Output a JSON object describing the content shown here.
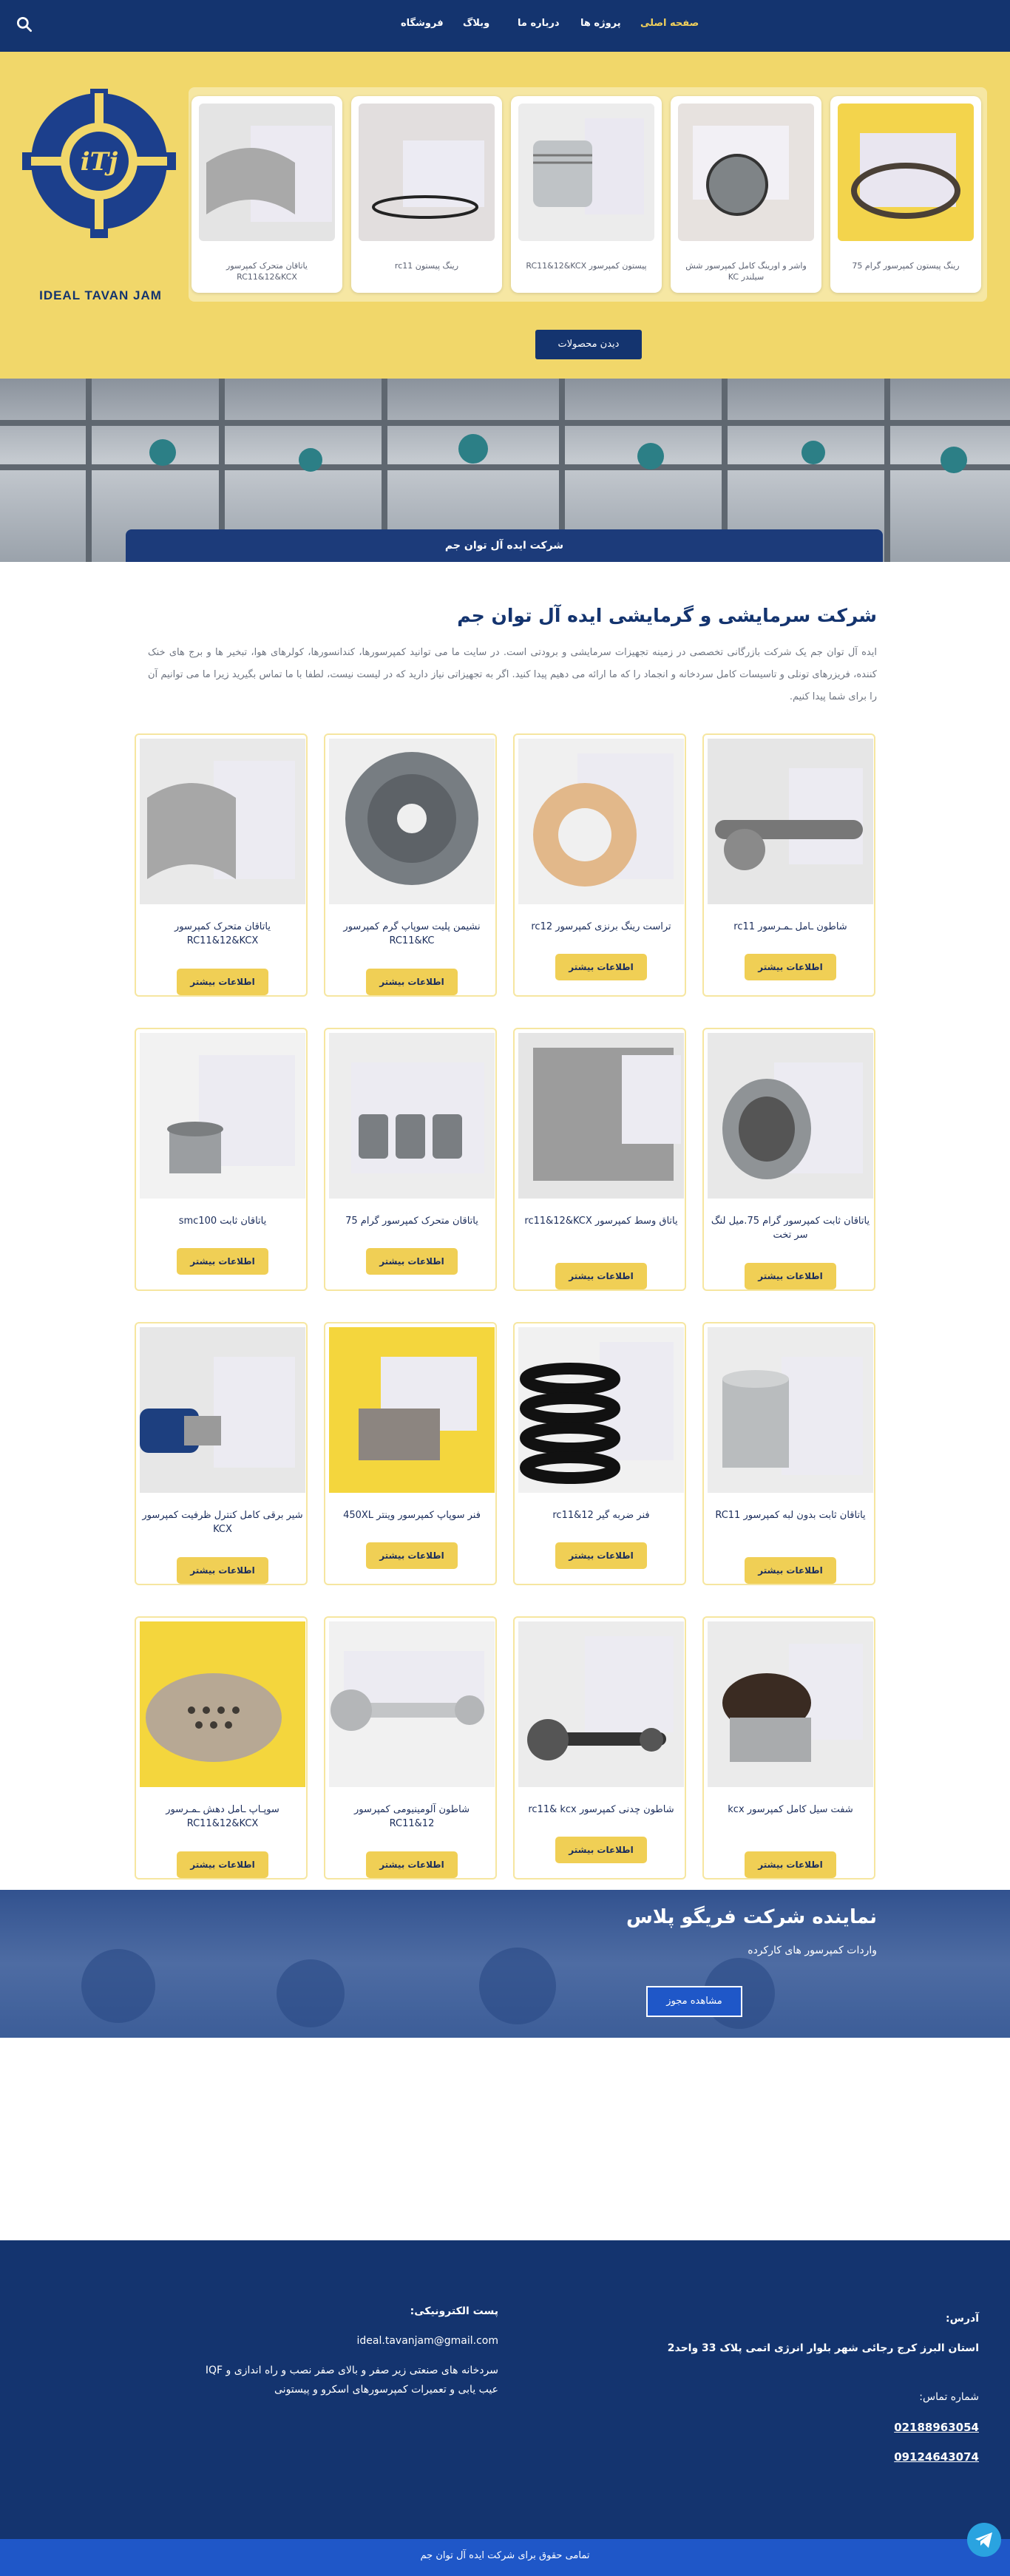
{
  "nav": {
    "items": [
      "صفحه اصلی",
      "پروژه ها",
      "درباره ما",
      "وبلاگ",
      "فروشگاه"
    ]
  },
  "logo": {
    "text": "IDEAL TAVAN JAM",
    "initials": "iTj"
  },
  "carousel": {
    "items": [
      "رینگ پیستون کمپرسور گرام 75",
      "واشر و اورینگ کامل کمپرسور شش سیلندر KC",
      "پیستون کمپرسور RC11&12&KCX",
      "رینگ پیستون rc11",
      "یاتاقان متحرک کمپرسور RC11&12&KCX"
    ],
    "button": "دیدن محصولات"
  },
  "banner": {
    "caption": "شرکت ایده آل توان جم"
  },
  "about": {
    "title": "شرکت سرمایشی و گرمایشی ایده آل توان جم",
    "text": "ایده آل توان جم یک شرکت بازرگانی تخصصی در زمینه تجهیزات سرمایشی و برودتی است. در سایت ما می توانید کمپرسورها، کندانسورها، کولرهای هوا، تبخیر ها و برج های خنک کننده، فریزرهای تونلی و تاسیسات کامل سردخانه و انجماد را که ما ارائه می دهیم پیدا کنید. اگر به تجهیزاتی نیاز دارید که در لیست نیست، لطفا با ما تماس بگیرید زیرا ما می توانیم آن را برای شما پیدا کنیم."
  },
  "products": {
    "more_label": "اطلاعات بیشتر",
    "items": [
      "شاطون ـامل ـمـرسور rc11",
      "تراست رینگ برنزی کمپرسور rc12",
      "نشیمن پلیت سوپاپ گرم کمپرسور RC11&KC",
      "یاتاقان متحرک کمپرسور RC11&12&KCX",
      "یاتاقان ثابت کمپرسور گرام 75.میل لنگ سر تخت",
      "یاتاق وسط کمپرسور rc11&12&KCX",
      "یاتاقان متحرک کمپرسور گرام 75",
      "یاتاقان ثابت smc100",
      "یاتاقان ثابت بدون لبه کمپرسور RC11",
      "فنر ضربه گیر rc11&12",
      "فنر سوپاپ کمپرسور وینتر 450XL",
      "شیر برقی کامل کنترل ظرفیت کمپرسور KCX",
      "شفت سیل کامل کمپرسور kcx",
      "شاطون چدنی کمپرسور rc11& kcx",
      "شاطون آلومینیومی کمپرسور RC11&12",
      "سوپـاپ ـامل دهش ـمـرسور RC11&12&KCX"
    ]
  },
  "agent": {
    "title": "نماینده شرکت فریگو پلاس",
    "subtitle": "واردات کمپرسور های کارکرده",
    "button": "مشاهده مجوز"
  },
  "footer": {
    "address_label": "آدرس:",
    "address": "استان البرز کرج رجائی شهر بلوار انرژی اتمی پلاک 33 واحد2",
    "phone_label": "شماره تماس:",
    "phones": [
      "02188963054",
      "09124643074"
    ],
    "email_label": "پست الکترونیکی:",
    "email": "ideal.tavanjam@gmail.com",
    "desc_1": "سردخانه های صنعتی زیر صفر و بالای صفر نصب و راه اندازی و IQF",
    "desc_2": "عیب یابی و تعمیرات کمپرسورهای اسکرو و پیستونی"
  },
  "copyright": "تمامی حقوق برای شرکت ایده آل توان جم",
  "colors": {
    "navy": "#14346f",
    "yellow": "#f1d76a",
    "button_yellow": "#f0cf55",
    "blue": "#1f57c8"
  }
}
